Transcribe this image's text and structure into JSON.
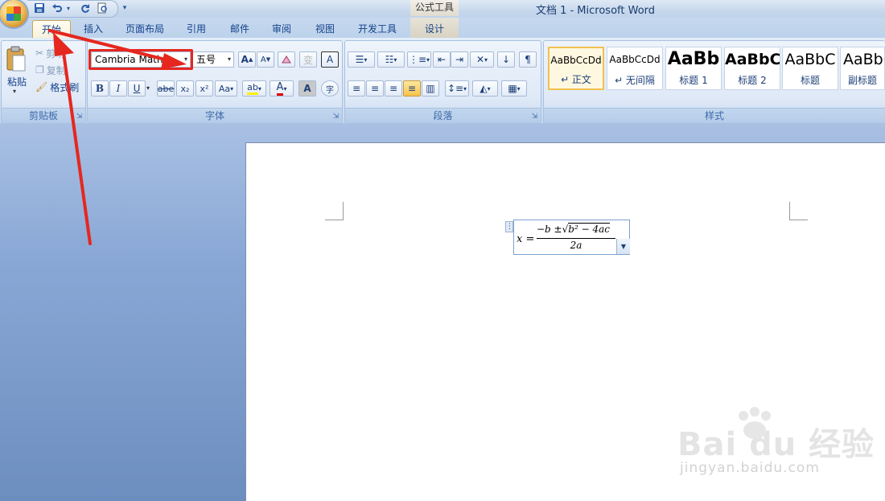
{
  "window": {
    "title": "文档 1 - Microsoft Word",
    "context_tool_title": "公式工具"
  },
  "quick_access": {
    "icons": [
      "save-icon",
      "undo-icon",
      "redo-icon",
      "print-preview-icon",
      "customize-icon"
    ]
  },
  "tabs": [
    {
      "label": "开始",
      "active": true
    },
    {
      "label": "插入"
    },
    {
      "label": "页面布局"
    },
    {
      "label": "引用"
    },
    {
      "label": "邮件"
    },
    {
      "label": "审阅"
    },
    {
      "label": "视图"
    },
    {
      "label": "开发工具"
    },
    {
      "label": "设计"
    }
  ],
  "clipboard": {
    "label": "剪贴板",
    "paste": "粘贴",
    "cut": "剪切",
    "copy": "复制",
    "format_painter": "格式刷"
  },
  "font": {
    "label": "字体",
    "font_name": "Cambria Math",
    "font_size": "五号",
    "grow": "A",
    "shrink": "A",
    "bold": "B",
    "italic": "I",
    "underline": "U",
    "strike": "abe",
    "subscript": "x₂",
    "superscript": "x²",
    "change_case": "Aa",
    "highlight": "ab",
    "font_color": "A",
    "char_shading": "A",
    "enclose": "字",
    "phonetic": "变",
    "char_border": "A"
  },
  "paragraph": {
    "label": "段落"
  },
  "styles": {
    "label": "样式",
    "items": [
      {
        "sample": "AaBbCcDd",
        "name": "↵ 正文",
        "active": true
      },
      {
        "sample": "AaBbCcDd",
        "name": "↵ 无间隔"
      },
      {
        "sample": "AaBb",
        "name": "标题 1"
      },
      {
        "sample": "AaBbC",
        "name": "标题 2"
      },
      {
        "sample": "AaBbC",
        "name": "标题"
      },
      {
        "sample": "AaBbC",
        "name": "副标题"
      }
    ]
  },
  "equation": {
    "lhs": "x",
    "numerator_pre": "−b ±",
    "radicand": "b² − 4ac",
    "denominator": "2a"
  },
  "watermark": {
    "logo": "Bai du 经验",
    "url": "jingyan.baidu.com"
  },
  "colors": {
    "annotation": "#e5271f",
    "active_tab_border": "#c7a85b"
  }
}
